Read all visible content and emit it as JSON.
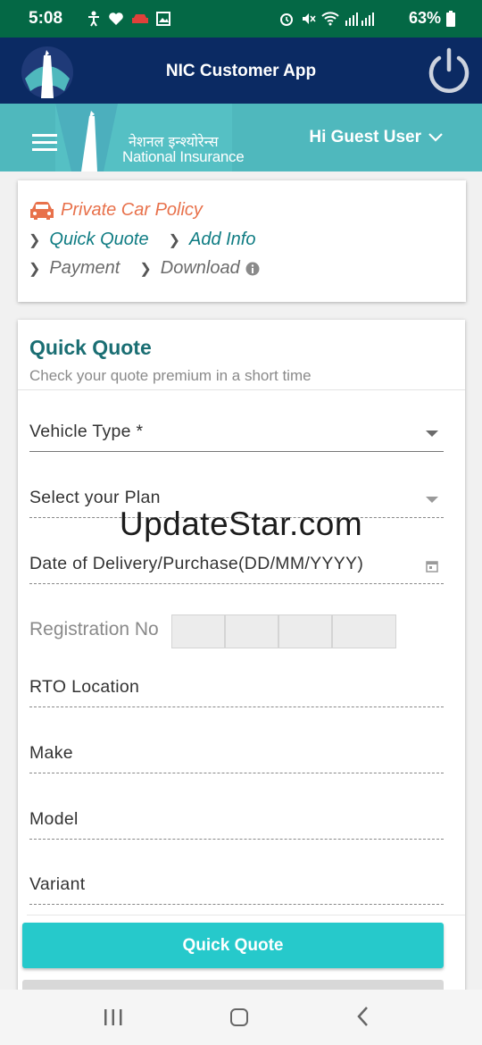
{
  "status_bar": {
    "time": "5:08",
    "battery": "63%"
  },
  "app_bar": {
    "title": "NIC Customer App"
  },
  "brand": {
    "hindi": "नेशनल इन्श्योरेन्स",
    "english": "National Insurance",
    "greeting": "Hi Guest User"
  },
  "breadcrumb": {
    "title": "Private Car Policy",
    "steps_row1": [
      "Quick Quote",
      "Add Info"
    ],
    "steps_row2": [
      "Payment",
      "Download"
    ]
  },
  "quick_quote": {
    "title": "Quick Quote",
    "subtitle": "Check your quote premium in a short time",
    "fields": {
      "vehicle_type": "Vehicle Type *",
      "plan": "Select your Plan",
      "date": "Date of Delivery/Purchase(DD/MM/YYYY)",
      "registration": "Registration No",
      "rto": "RTO Location",
      "make": "Make",
      "model": "Model",
      "variant": "Variant"
    },
    "button": "Quick Quote"
  },
  "watermark": "UpdateStar.com",
  "colors": {
    "status_bar": "#046845",
    "app_bar": "#0b2a63",
    "brand_bar": "#4fb8bd",
    "title_teal": "#1a6e73",
    "accent_orange": "#e8714b",
    "cta": "#26c9cb"
  }
}
